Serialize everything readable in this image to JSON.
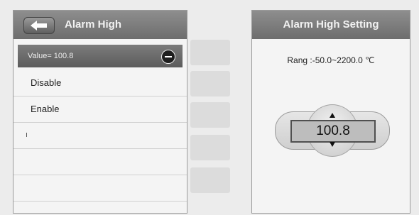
{
  "left_panel": {
    "title": "Alarm High",
    "items": [
      {
        "label": "Value= 100.8",
        "selected": true
      },
      {
        "label": "Disable"
      },
      {
        "label": "Enable"
      },
      {
        "label": ""
      },
      {
        "label": ""
      },
      {
        "label": ""
      }
    ]
  },
  "right_panel": {
    "title": "Alarm High Setting",
    "range_text": "Rang :-50.0~2200.0 ℃",
    "value": "100.8"
  },
  "icons": {
    "back": "back-arrow-icon",
    "minus": "minus-circle-icon",
    "up": "arrow-up-icon",
    "down": "arrow-down-icon"
  }
}
